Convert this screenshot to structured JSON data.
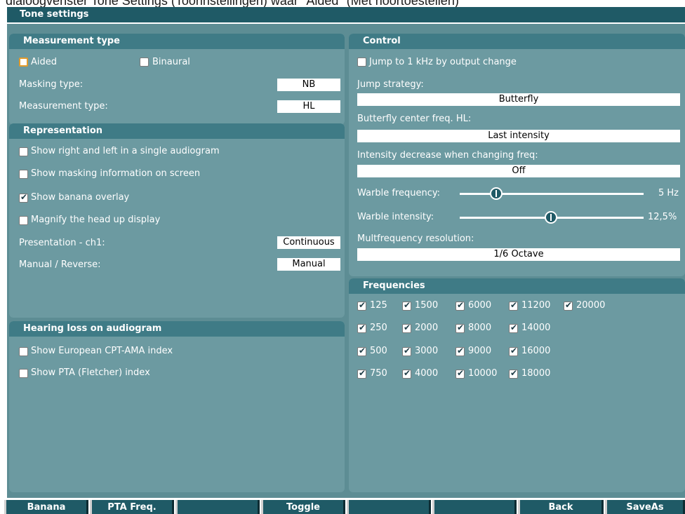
{
  "caption": "dialoogvenster Tone Settings (Toonnstellingen) waar \"Aided\" (Met hoortoestellen)",
  "window": {
    "title": "Tone settings"
  },
  "measurement_type": {
    "header": "Measurement type",
    "aided_label": "Aided",
    "aided_checked": false,
    "binaural_label": "Binaural",
    "binaural_checked": false,
    "masking_type_label": "Masking type:",
    "masking_type_value": "NB",
    "measurement_type_label": "Measurement type:",
    "measurement_type_value": "HL"
  },
  "representation": {
    "header": "Representation",
    "options": [
      {
        "label": "Show right and left in a single audiogram",
        "checked": false
      },
      {
        "label": "Show masking information on screen",
        "checked": false
      },
      {
        "label": "Show banana overlay",
        "checked": true
      },
      {
        "label": "Magnify the head up display",
        "checked": false
      }
    ],
    "presentation_label": "Presentation - ch1:",
    "presentation_value": "Continuous",
    "manual_label": "Manual / Reverse:",
    "manual_value": "Manual"
  },
  "hearing_loss": {
    "header": "Hearing loss on audiogram",
    "options": [
      {
        "label": "Show European CPT-AMA index",
        "checked": false
      },
      {
        "label": "Show PTA (Fletcher) index",
        "checked": false
      }
    ]
  },
  "control": {
    "header": "Control",
    "jump_label": "Jump to 1 kHz by output change",
    "jump_checked": false,
    "jump_strategy_label": "Jump strategy:",
    "jump_strategy_value": "Butterfly",
    "butterfly_label": "Butterfly center freq. HL:",
    "butterfly_value": "Last intensity",
    "intensity_decrease_label": "Intensity decrease when changing freq:",
    "intensity_decrease_value": "Off",
    "warble_freq_label": "Warble frequency:",
    "warble_freq_value": "5 Hz",
    "warble_freq_level": 0.2,
    "warble_int_label": "Warble intensity:",
    "warble_int_value": "12,5%",
    "warble_int_level": 0.5,
    "multifreq_label": "Multfrequency resolution:",
    "multifreq_value": "1/6 Octave"
  },
  "frequencies": {
    "header": "Frequencies",
    "rows": [
      [
        "125",
        "1500",
        "6000",
        "11200",
        "20000"
      ],
      [
        "250",
        "2000",
        "8000",
        "14000"
      ],
      [
        "500",
        "3000",
        "9000",
        "16000"
      ],
      [
        "750",
        "4000",
        "10000",
        "18000"
      ]
    ],
    "all_checked": true
  },
  "function_bar": {
    "buttons": [
      "Banana",
      "PTA Freq.",
      "",
      "Toggle",
      "",
      "",
      "Back",
      "SaveAs"
    ]
  }
}
